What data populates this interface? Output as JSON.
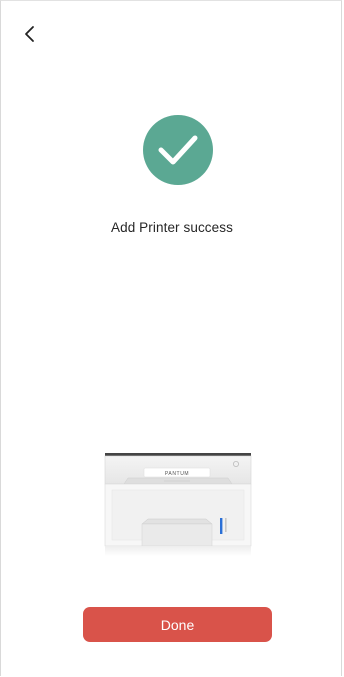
{
  "header": {
    "back_icon": "chevron-left-icon"
  },
  "status": {
    "icon": "checkmark-icon",
    "icon_color": "#5ba893",
    "message": "Add Printer success"
  },
  "printer": {
    "brand": "PANTUM"
  },
  "actions": {
    "done_label": "Done",
    "done_color": "#d9534a"
  }
}
